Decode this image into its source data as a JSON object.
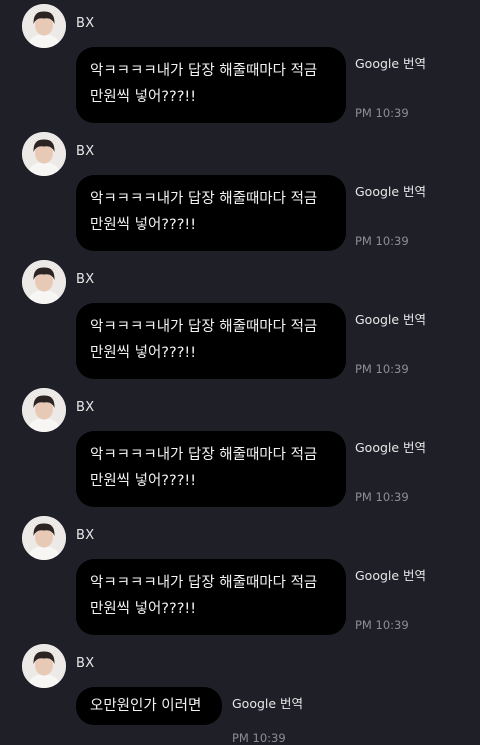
{
  "messages": [
    {
      "sender": "BX",
      "text": "악ㅋㅋㅋㅋ내가 답장 해줄때마다 적금 만원씩 넣어???!!",
      "translate": "Google 번역",
      "time": "PM 10:39"
    },
    {
      "sender": "BX",
      "text": "악ㅋㅋㅋㅋ내가 답장 해줄때마다 적금 만원씩 넣어???!!",
      "translate": "Google 번역",
      "time": "PM 10:39"
    },
    {
      "sender": "BX",
      "text": "악ㅋㅋㅋㅋ내가 답장 해줄때마다 적금 만원씩 넣어???!!",
      "translate": "Google 번역",
      "time": "PM 10:39"
    },
    {
      "sender": "BX",
      "text": "악ㅋㅋㅋㅋ내가 답장 해줄때마다 적금 만원씩 넣어???!!",
      "translate": "Google 번역",
      "time": "PM 10:39"
    },
    {
      "sender": "BX",
      "text": "악ㅋㅋㅋㅋ내가 답장 해줄때마다 적금 만원씩 넣어???!!",
      "translate": "Google 번역",
      "time": "PM 10:39"
    },
    {
      "sender": "BX",
      "text": "오만원인가 이러면",
      "translate": "Google 번역",
      "time": "PM 10:39"
    }
  ],
  "colors": {
    "background": "#1f1f28",
    "bubble": "#000000",
    "text": "#f2f2f2",
    "timestamp": "#8d8d97"
  },
  "icons": {
    "avatar": "profile-photo"
  }
}
